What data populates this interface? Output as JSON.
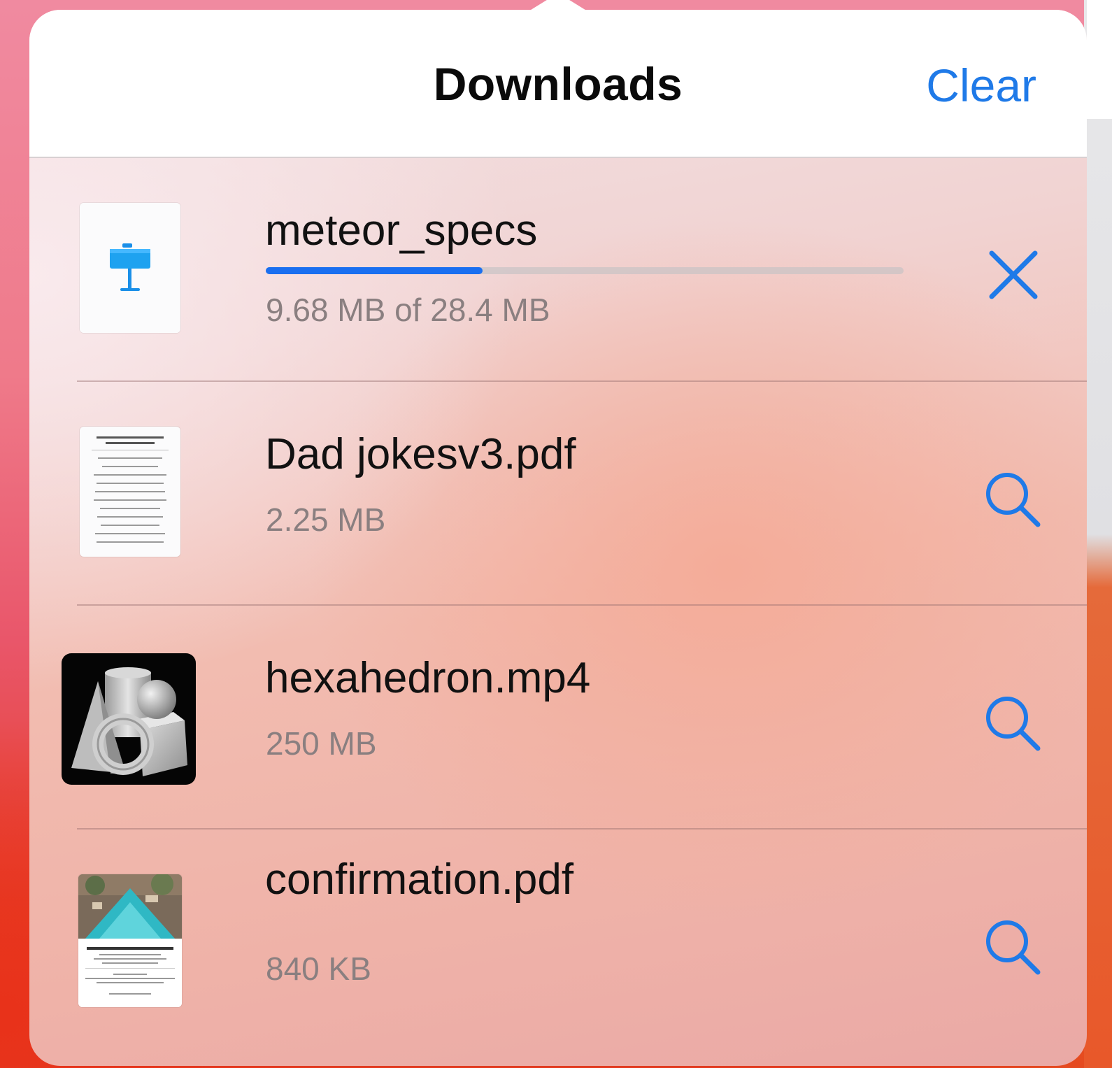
{
  "header": {
    "title": "Downloads",
    "clear_label": "Clear"
  },
  "colors": {
    "accent": "#1f7ae8",
    "progress": "#1a6ff0",
    "title": "#0a0a0a",
    "secondary_text": "#8a7f80"
  },
  "downloads": [
    {
      "filename": "meteor_specs",
      "size_text": "9.68 MB of 28.4 MB",
      "progress": 0.34,
      "thumbnail_icon": "keynote-icon",
      "action_icon": "close-icon"
    },
    {
      "filename": "Dad jokesv3.pdf",
      "size_text": "2.25 MB",
      "thumbnail_icon": "pdf-document-thumbnail",
      "action_icon": "magnifying-glass-icon"
    },
    {
      "filename": "hexahedron.mp4",
      "size_text": "250 MB",
      "thumbnail_icon": "3d-shapes-thumbnail",
      "action_icon": "magnifying-glass-icon"
    },
    {
      "filename": "confirmation.pdf",
      "size_text": "840 KB",
      "thumbnail_icon": "pool-photo-pdf-thumbnail",
      "action_icon": "magnifying-glass-icon"
    }
  ]
}
